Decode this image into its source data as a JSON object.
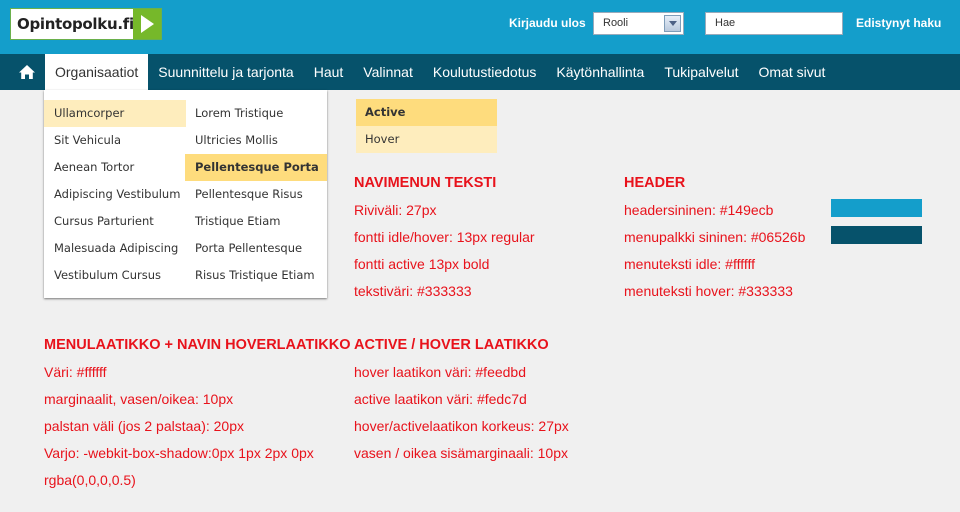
{
  "header": {
    "logo_text": "Opintopolku.fi",
    "logout": "Kirjaudu ulos",
    "role_select_value": "Rooli",
    "search_placeholder": "Hae",
    "advanced_search": "Edistynyt haku"
  },
  "nav": {
    "items": [
      "Organisaatiot",
      "Suunnittelu ja tarjonta",
      "Haut",
      "Valinnat",
      "Koulutustiedotus",
      "Käytönhallinta",
      "Tukipalvelut",
      "Omat sivut"
    ],
    "active_index": 0
  },
  "dropdown": {
    "col1": [
      "Ullamcorper",
      "Sit Vehicula",
      "Aenean Tortor",
      "Adipiscing Vestibulum",
      "Cursus Parturient",
      "Malesuada Adipiscing",
      "Vestibulum Cursus"
    ],
    "col2": [
      "Lorem Tristique",
      "Ultricies Mollis",
      "Pellentesque Porta",
      "Pellentesque Risus",
      "Tristique Etiam",
      "Porta Pellentesque",
      "Risus Tristique Etiam"
    ]
  },
  "samples": {
    "active": "Active",
    "hover": "Hover"
  },
  "specs": {
    "navimenu": {
      "title": "NAVIMENUN TEKSTI",
      "lines": [
        "Riviväli: 27px",
        "fontti idle/hover: 13px regular",
        "fontti active 13px bold",
        "tekstiväri: #333333"
      ]
    },
    "header": {
      "title": "HEADER",
      "lines": [
        "headersininen: #149ecb",
        "menupalkki sininen: #06526b",
        "menuteksti idle: #ffffff",
        "menuteksti hover: #333333"
      ]
    },
    "menulaatikko": {
      "title": "MENULAATIKKO + NAVIN HOVERLAATIKKO",
      "lines": [
        "Väri: #ffffff",
        "marginaalit, vasen/oikea: 10px",
        "palstan väli (jos 2 palstaa): 20px",
        "Varjo: -webkit-box-shadow:0px 1px 2px 0px",
        "rgba(0,0,0,0.5)"
      ]
    },
    "activehover": {
      "title": "ACTIVE / HOVER LAATIKKO",
      "lines": [
        "hover laatikon väri: #feedbd",
        "active laatikon väri: #fedc7d",
        "hover/activelaatikon korkeus: 27px",
        "vasen / oikea sisämarginaali: 10px"
      ]
    }
  },
  "colors": {
    "header_blue": "#149ecb",
    "menu_bar_blue": "#06526b",
    "hover_box": "#feedbd",
    "active_box": "#fedc7d",
    "spec_text": "#e8121b"
  },
  "icons": {
    "home": "home-icon",
    "logo_arrow": "play-arrow-icon",
    "select_arrow": "chevron-down-icon"
  }
}
